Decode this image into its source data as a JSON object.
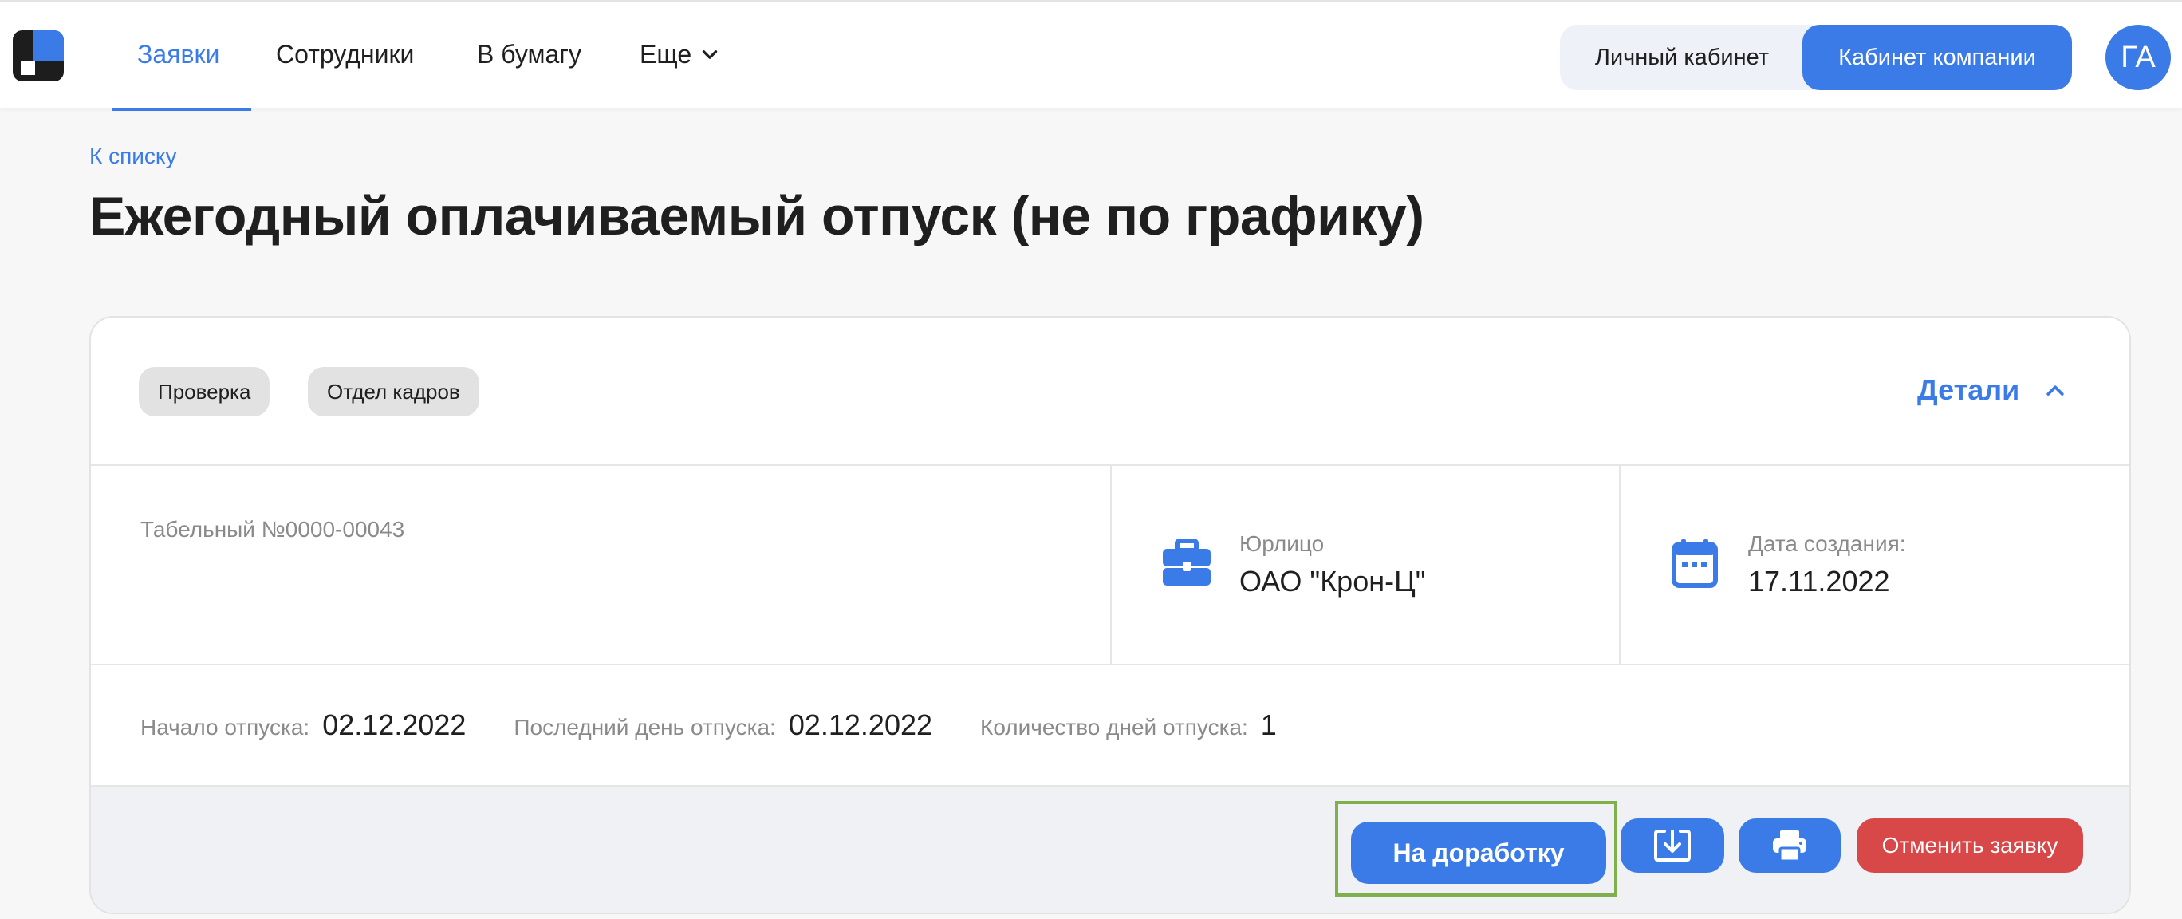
{
  "header": {
    "nav": {
      "requests": "Заявки",
      "employees": "Сотрудники",
      "to_paper": "В бумагу",
      "more": "Еще"
    },
    "cabinet": {
      "personal": "Личный кабинет",
      "company": "Кабинет компании"
    },
    "avatar_initials": "ГА"
  },
  "page": {
    "back_link": "К списку",
    "title": "Ежегодный оплачиваемый отпуск (не по графику)"
  },
  "card": {
    "badges": [
      "Проверка",
      "Отдел кадров"
    ],
    "details_label": "Детали",
    "tab_number": "Табельный №0000-00043",
    "legal_entity": {
      "label": "Юрлицо",
      "value": "ОАО \"Крон-Ц\"",
      "icon": "briefcase-icon"
    },
    "created": {
      "label": "Дата создания:",
      "value": "17.11.2022",
      "icon": "calendar-icon"
    },
    "vacation": {
      "start_label": "Начало отпуска:",
      "start_value": "02.12.2022",
      "end_label": "Последний день отпуска:",
      "end_value": "02.12.2022",
      "days_label": "Количество дней отпуска:",
      "days_value": "1"
    },
    "actions": {
      "rework": "На доработку",
      "download_icon": "download-icon",
      "print_icon": "printer-icon",
      "cancel": "Отменить заявку"
    }
  },
  "colors": {
    "accent": "#3a7be8",
    "danger": "#d94848",
    "highlight": "#7fb04c"
  }
}
